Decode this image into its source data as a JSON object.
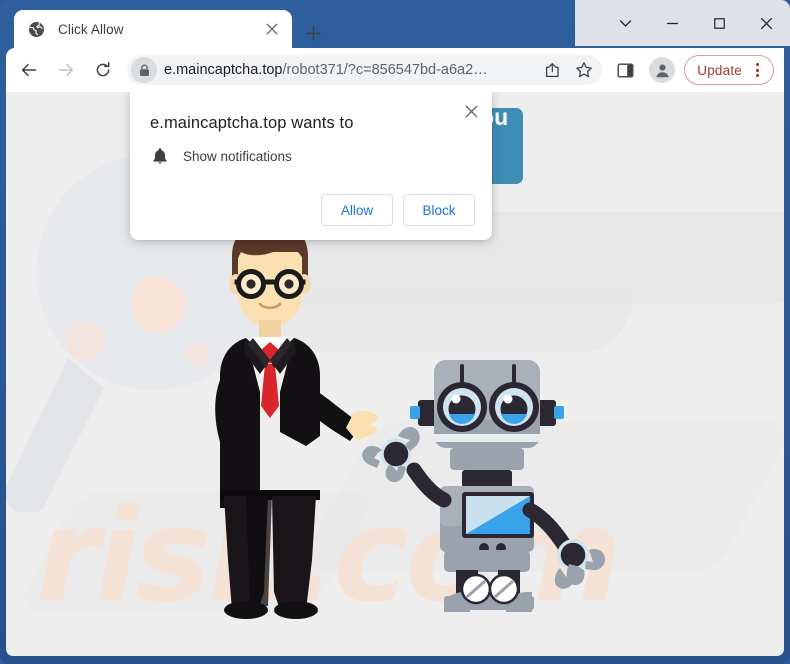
{
  "window": {
    "caption_buttons": [
      {
        "name": "tab-search",
        "icon": "chevron-down-icon",
        "label": "⌄"
      },
      {
        "name": "minimize",
        "icon": "minimize-icon",
        "label": "—"
      },
      {
        "name": "maximize",
        "icon": "maximize-icon",
        "label": "☐"
      },
      {
        "name": "close",
        "icon": "close-icon",
        "label": "✕"
      }
    ]
  },
  "tabstrip": {
    "tab": {
      "title": "Click Allow",
      "favicon": "globe-icon",
      "close_label": "✕"
    },
    "new_tab_label": "+"
  },
  "toolbar": {
    "back_label": "←",
    "forward_label": "→",
    "reload_label": "↻",
    "lock_icon": "lock-icon",
    "url_prefix": "e.maincaptcha.top",
    "url_suffix": "/robot371/?c=856547bd-a6a2…",
    "share_icon": "share-icon",
    "bookmark_icon": "star-icon",
    "side_panel_icon": "side-panel-icon",
    "profile_icon": "person-icon",
    "update_label": "Update",
    "menu_icon": "three-dot-menu-icon",
    "update_accent": "#b3261e"
  },
  "page": {
    "cta_text": "Confirm you are not a robot!",
    "watermark_text": "risk.com",
    "background_color": "#eeeeee",
    "cta_color": "#3d8db5"
  },
  "dialog": {
    "title": "e.maincaptcha.top wants to",
    "permission_icon": "bell-icon",
    "permission_label": "Show notifications",
    "allow_label": "Allow",
    "block_label": "Block",
    "close_label": "✕",
    "button_text_color": "#1a73e8"
  }
}
